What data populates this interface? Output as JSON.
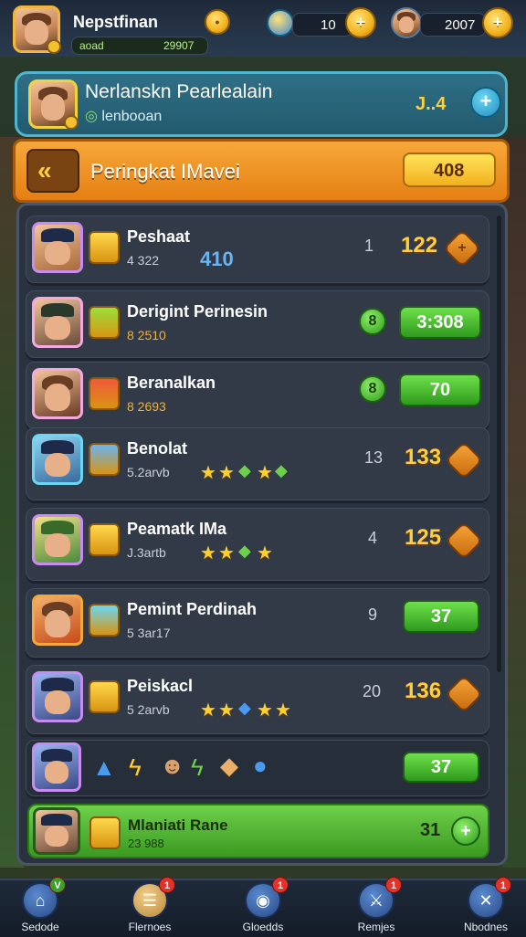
{
  "header": {
    "player_name": "Nepstfinan",
    "player_sub_left": "aoad",
    "player_sub_right": "29907",
    "currency1_value": "10",
    "currency2_value": "2007"
  },
  "profile_panel": {
    "title": "Nerlanskn Pearlealain",
    "subtitle": "lenbooan",
    "value": "J..4",
    "button": "+"
  },
  "banner": {
    "title": "Peringkat IMavei",
    "value": "408"
  },
  "rows": [
    {
      "name": "Peshaat",
      "sub": "4 322",
      "icons": "410",
      "rank": "1",
      "score": "122",
      "kind": "score"
    },
    {
      "name": "Derigint Perinesin",
      "sub": "8 2510",
      "rank": "",
      "score": "",
      "badge": "8",
      "button": "3:308",
      "kind": "button"
    },
    {
      "name": "Beranalkan",
      "sub": "8 2693",
      "rank": "",
      "score": "",
      "badge": "8",
      "button": "70",
      "kind": "button"
    },
    {
      "name": "Benolat",
      "sub": "5.2arvb",
      "rank": "13",
      "score": "133",
      "kind": "score"
    },
    {
      "name": "Peamatk IMa",
      "sub": "J.3artb",
      "rank": "4",
      "score": "125",
      "kind": "score"
    },
    {
      "name": "Pemint Perdinah",
      "sub": "5 3ar17",
      "rank": "9",
      "score": "",
      "button": "37",
      "kind": "button"
    },
    {
      "name": "Peiskacl",
      "sub": "5 2arvb",
      "rank": "20",
      "score": "136",
      "kind": "score"
    }
  ],
  "unit_row": {
    "button": "37"
  },
  "player_row": {
    "name": "Mlaniati Rane",
    "sub": "23 988",
    "value": "31"
  },
  "nav": [
    {
      "label": "Sedode",
      "notif": "V"
    },
    {
      "label": "Flernoes",
      "notif": "1"
    },
    {
      "label": "Gloedds",
      "notif": "1"
    },
    {
      "label": "Remjes",
      "notif": "1"
    },
    {
      "label": "Nbodnes",
      "notif": "1"
    }
  ]
}
